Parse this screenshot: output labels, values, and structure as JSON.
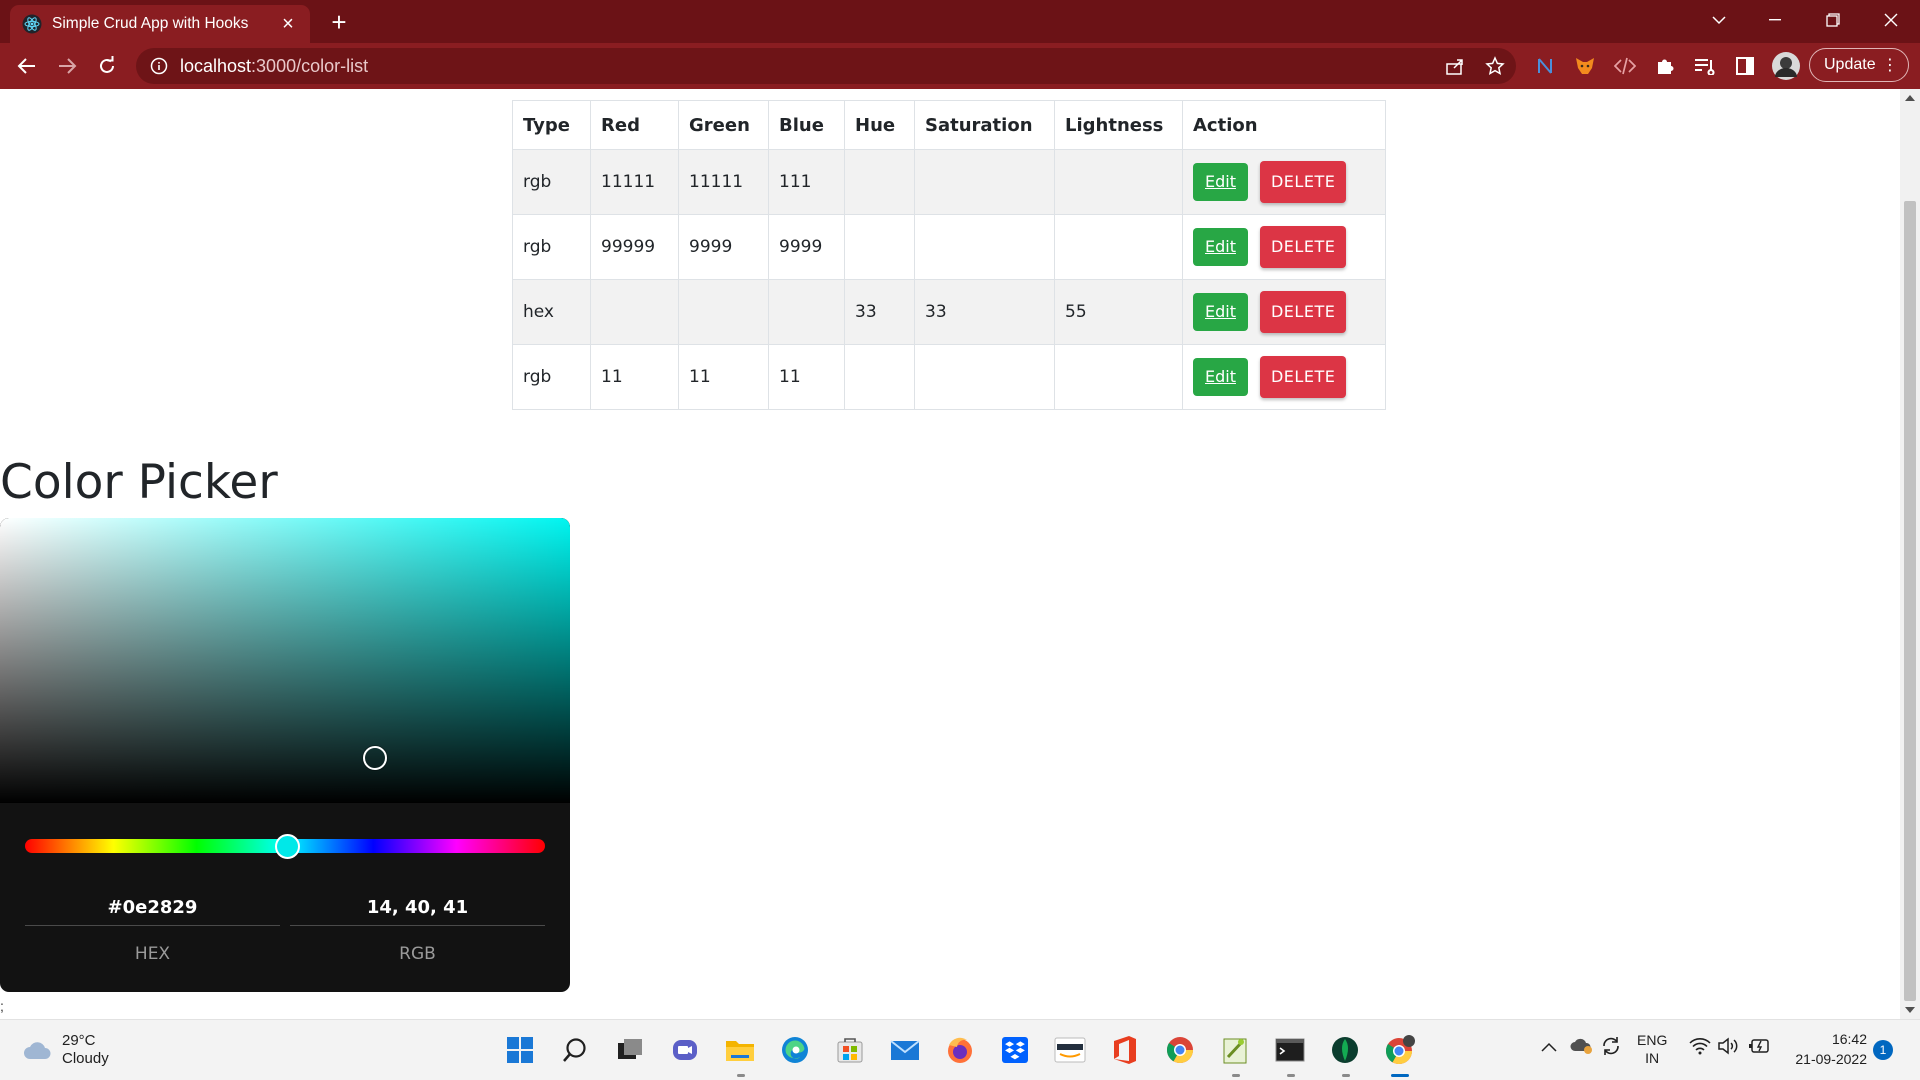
{
  "browser": {
    "tab_title": "Simple Crud App with Hooks",
    "url_host": "localhost",
    "url_path": ":3000/color-list",
    "update_label": "Update",
    "theme_color": "#8a1d21"
  },
  "table": {
    "headers": [
      "Type",
      "Red",
      "Green",
      "Blue",
      "Hue",
      "Saturation",
      "Lightness",
      "Action"
    ],
    "rows": [
      {
        "type": "rgb",
        "red": "11111",
        "green": "11111",
        "blue": "111",
        "hue": "",
        "saturation": "",
        "lightness": ""
      },
      {
        "type": "rgb",
        "red": "99999",
        "green": "9999",
        "blue": "9999",
        "hue": "",
        "saturation": "",
        "lightness": ""
      },
      {
        "type": "hex",
        "red": "",
        "green": "",
        "blue": "",
        "hue": "33",
        "saturation": "33",
        "lightness": "55"
      },
      {
        "type": "rgb",
        "red": "11",
        "green": "11",
        "blue": "11",
        "hue": "",
        "saturation": "",
        "lightness": ""
      }
    ],
    "edit_label": "Edit",
    "delete_label": "DELETE",
    "edit_color": "#28a745",
    "delete_color": "#dc3545"
  },
  "picker": {
    "heading": "Color Picker",
    "hex_value": "#0e2829",
    "rgb_value": "14, 40, 41",
    "hex_label": "HEX",
    "rgb_label": "RGB",
    "stray_text": ";"
  },
  "taskbar": {
    "temperature": "29°C",
    "condition": "Cloudy",
    "lang": "ENG",
    "region": "IN",
    "time": "16:42",
    "date": "21-09-2022",
    "notification_count": "1"
  }
}
